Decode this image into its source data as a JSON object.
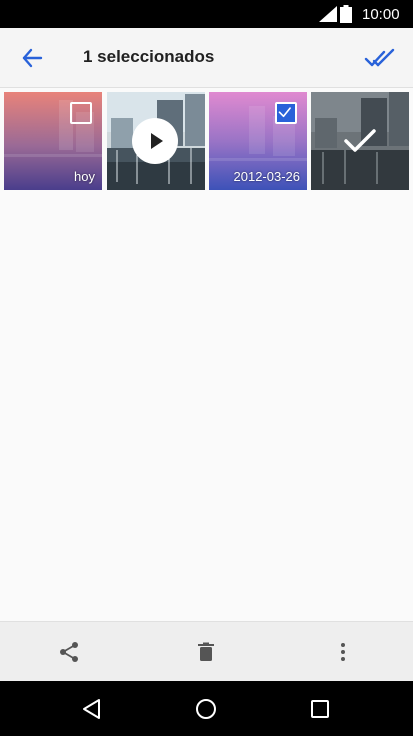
{
  "status_bar": {
    "time": "10:00",
    "icons": [
      "signal-icon",
      "battery-icon"
    ]
  },
  "action_bar": {
    "title": "1 seleccionados",
    "back_icon": "arrow-left-icon",
    "select_all_icon": "double-check-icon",
    "accent_color": "#2962d9"
  },
  "grid": {
    "items": [
      {
        "label": "hoy",
        "selected": false,
        "type": "photo"
      },
      {
        "label": "",
        "selected": false,
        "type": "video"
      },
      {
        "label": "2012-03-26",
        "selected": true,
        "type": "photo"
      },
      {
        "label": "",
        "selected": true,
        "type": "photo"
      }
    ]
  },
  "toolbar": {
    "icons": [
      "share-icon",
      "trash-icon",
      "more-vert-icon"
    ]
  },
  "nav_bar": {
    "icons": [
      "nav-back-icon",
      "nav-home-icon",
      "nav-recents-icon"
    ]
  }
}
